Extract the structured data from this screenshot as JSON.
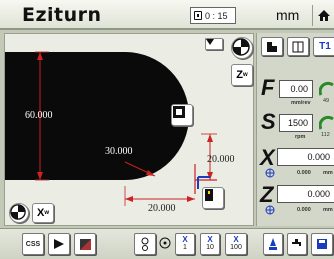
{
  "app": {
    "title": "Eziturn"
  },
  "header": {
    "timer": "0 : 15",
    "units": "mm"
  },
  "canvas": {
    "dims": {
      "height_60": "60.000",
      "radius_30": "30.000",
      "right_20": "20.000",
      "bottom_20": "20.000"
    },
    "zoom_label": "Z",
    "zoom_sub": "w",
    "xw_label": "X",
    "xw_sub": "w"
  },
  "right_panel": {
    "tool": "T1",
    "feed": {
      "letter": "F",
      "value": "0.00",
      "unit": "mm/rev",
      "gauge": "49"
    },
    "speed": {
      "letter": "S",
      "value": "1500",
      "unit": "rpm",
      "gauge": "112"
    },
    "x": {
      "letter": "X",
      "value": "0.000",
      "sub": "0.000",
      "unit": "mm"
    },
    "z": {
      "letter": "Z",
      "value": "0.000",
      "sub": "0.000",
      "unit": "mm"
    }
  },
  "bottom": {
    "css_label": "CSS",
    "steps": [
      {
        "axis": "X",
        "value": "1"
      },
      {
        "axis": "X",
        "value": "10"
      },
      {
        "axis": "X",
        "value": "100"
      }
    ]
  }
}
